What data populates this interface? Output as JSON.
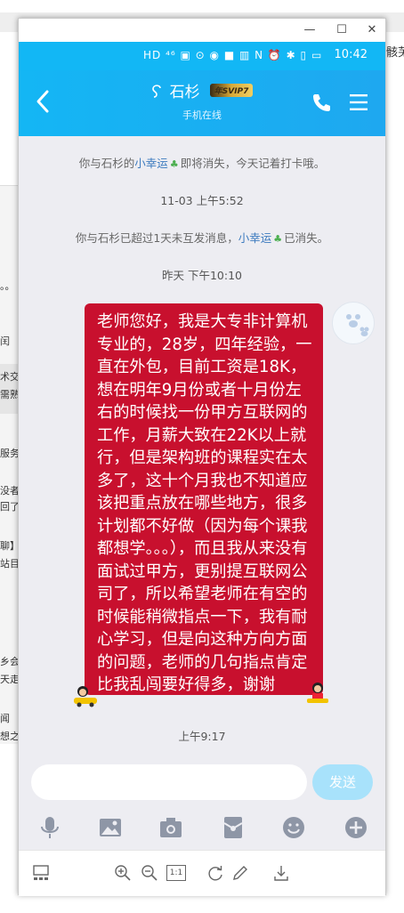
{
  "background": {
    "right_edge_text": "骸芜",
    "left_fragments": [
      "。。",
      "闰",
      "术交",
      "需熟",
      "服务",
      "没者",
      "回了",
      "聊】",
      "站目",
      "乡会",
      "天走",
      "闻",
      "想之"
    ]
  },
  "window": {
    "controls": {
      "minimize": "—",
      "maximize": "☐",
      "close": "✕"
    }
  },
  "statusbar": {
    "icons_text": "HD ⁴⁶ ▣ ⊙ ◉ ■ ▥ N ⏰ ✱ ▯ ▭",
    "time": "10:42"
  },
  "header": {
    "contact_name": "石杉",
    "vip_badge": "年SVIP7",
    "status": "手机在线"
  },
  "messages": {
    "system_1": {
      "before": "你与石杉的",
      "link": "小幸运",
      "after": "即将消失，今天记着打卡哦。"
    },
    "timestamp_1": "11-03 上午5:52",
    "system_2": {
      "before": "你与石杉已超过1天未互发消息，",
      "link": "小幸运",
      "after": "已消失。"
    },
    "timestamp_2": "昨天 下午10:10",
    "bubble_text": "老师您好，我是大专非计算机专业的，28岁，四年经验，一直在外包，目前工资是18K，想在明年9月份或者十月份左右的时候找一份甲方互联网的工作，月薪大致在22K以上就行，但是架构班的课程实在太多了，这十个月我也不知道应该把重点放在哪些地方，很多计划都不好做（因为每个课我都想学。。。），而且我从来没有面试过甲方，更别提互联网公司了，所以希望老师在有空的时候能稍微指点一下，我有耐心学习，但是向这种方向方面的问题，老师的几句指点肯定比我乱闯要好得多，谢谢",
    "timestamp_3": "上午9:17"
  },
  "composer": {
    "input_value": "",
    "send_label": "发送"
  },
  "viewer_toolbar": {
    "one_to_one": "1:1"
  },
  "colors": {
    "qq_blue": "#12b7f5",
    "bubble_red": "#c8102e",
    "send_disabled": "#a8e2fb"
  }
}
